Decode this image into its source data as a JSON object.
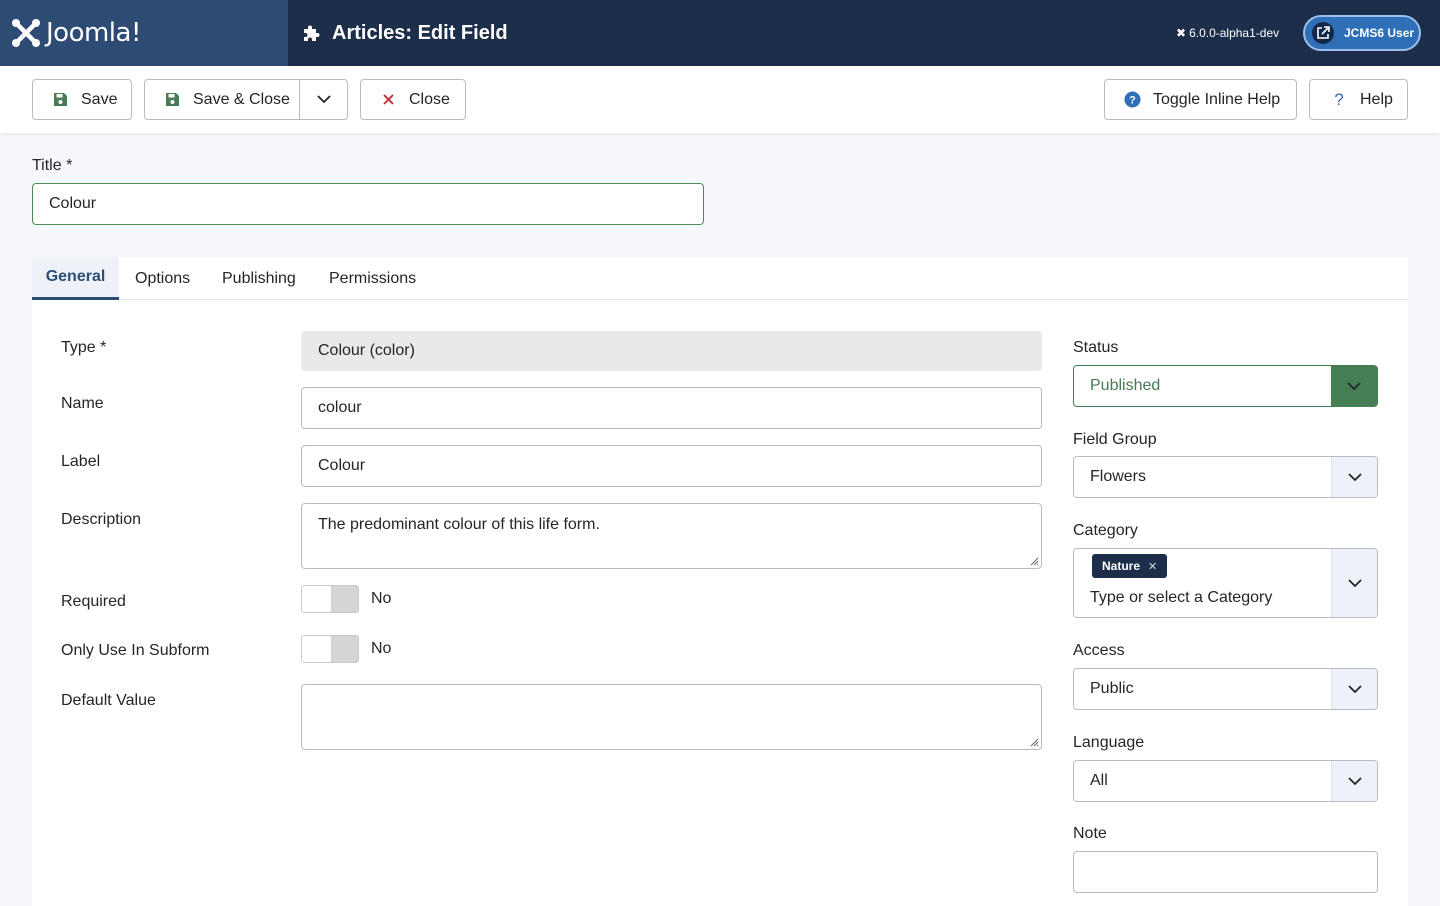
{
  "header": {
    "logo_text": "Joomla!",
    "page_title": "Articles: Edit Field",
    "version": "6.0.0-alpha1-dev",
    "user_label": "JCMS6 User"
  },
  "toolbar": {
    "save_label": "Save",
    "save_close_label": "Save & Close",
    "close_label": "Close",
    "toggle_help_label": "Toggle Inline Help",
    "help_label": "Help"
  },
  "title_field": {
    "label": "Title *",
    "value": "Colour"
  },
  "tabs": [
    {
      "label": "General"
    },
    {
      "label": "Options"
    },
    {
      "label": "Publishing"
    },
    {
      "label": "Permissions"
    }
  ],
  "general": {
    "type_label": "Type *",
    "type_value": "Colour (color)",
    "name_label": "Name",
    "name_value": "colour",
    "label_label": "Label",
    "label_value": "Colour",
    "description_label": "Description",
    "description_value": "The predominant colour of this life form.",
    "required_label": "Required",
    "required_value": "No",
    "subform_label": "Only Use In Subform",
    "subform_value": "No",
    "default_label": "Default Value",
    "default_value": ""
  },
  "sidebar": {
    "status_label": "Status",
    "status_value": "Published",
    "field_group_label": "Field Group",
    "field_group_value": "Flowers",
    "category_label": "Category",
    "category_chip": "Nature",
    "category_placeholder": "Type or select a Category",
    "access_label": "Access",
    "access_value": "Public",
    "language_label": "Language",
    "language_value": "All",
    "note_label": "Note",
    "note_value": ""
  },
  "colors": {
    "header_bg": "#1c2e4a",
    "logo_bg": "#2e4b74",
    "accent_green": "#457d54",
    "tab_active": "#2c4d75",
    "close_icon": "#c52827",
    "help_icon": "#2f6fb8"
  }
}
